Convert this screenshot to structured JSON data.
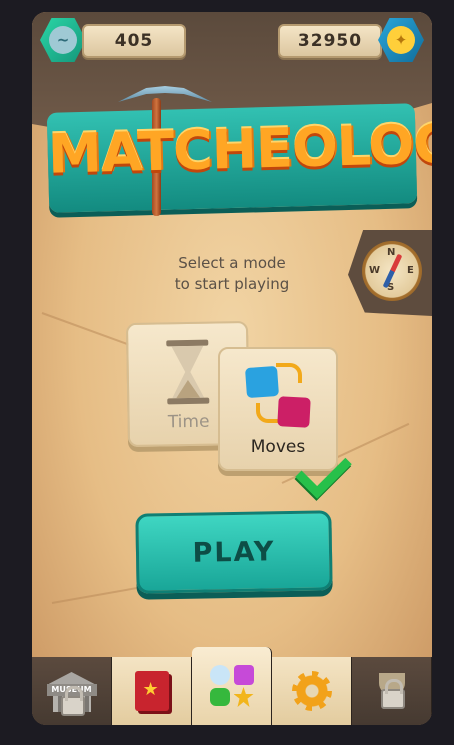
{
  "header": {
    "left_counter": "405",
    "left_gem_icon": "stone-coin-icon",
    "right_counter": "32950",
    "right_gem_icon": "gold-coin-icon"
  },
  "logo": {
    "title": "MATCHEOLOGY"
  },
  "intro": {
    "line1": "Select a mode",
    "line2": "to start playing"
  },
  "compass": {
    "n": "N",
    "s": "S",
    "w": "W",
    "e": "E"
  },
  "modes": [
    {
      "label": "Time",
      "selected": false,
      "icon": "hourglass-icon"
    },
    {
      "label": "Moves",
      "selected": true,
      "icon": "swap-tiles-icon"
    }
  ],
  "play_button": {
    "label": "PLAY"
  },
  "bottom_nav": {
    "museum_label": "MUSEUM",
    "tabs": [
      {
        "name": "museum",
        "locked": true
      },
      {
        "name": "collection-book",
        "locked": false
      },
      {
        "name": "play",
        "locked": false,
        "active": true
      },
      {
        "name": "settings",
        "locked": false
      },
      {
        "name": "trophies",
        "locked": true
      }
    ]
  },
  "colors": {
    "accent_teal": "#1fb3a4",
    "logo_orange": "#ffa624",
    "check_green": "#27c04a"
  }
}
